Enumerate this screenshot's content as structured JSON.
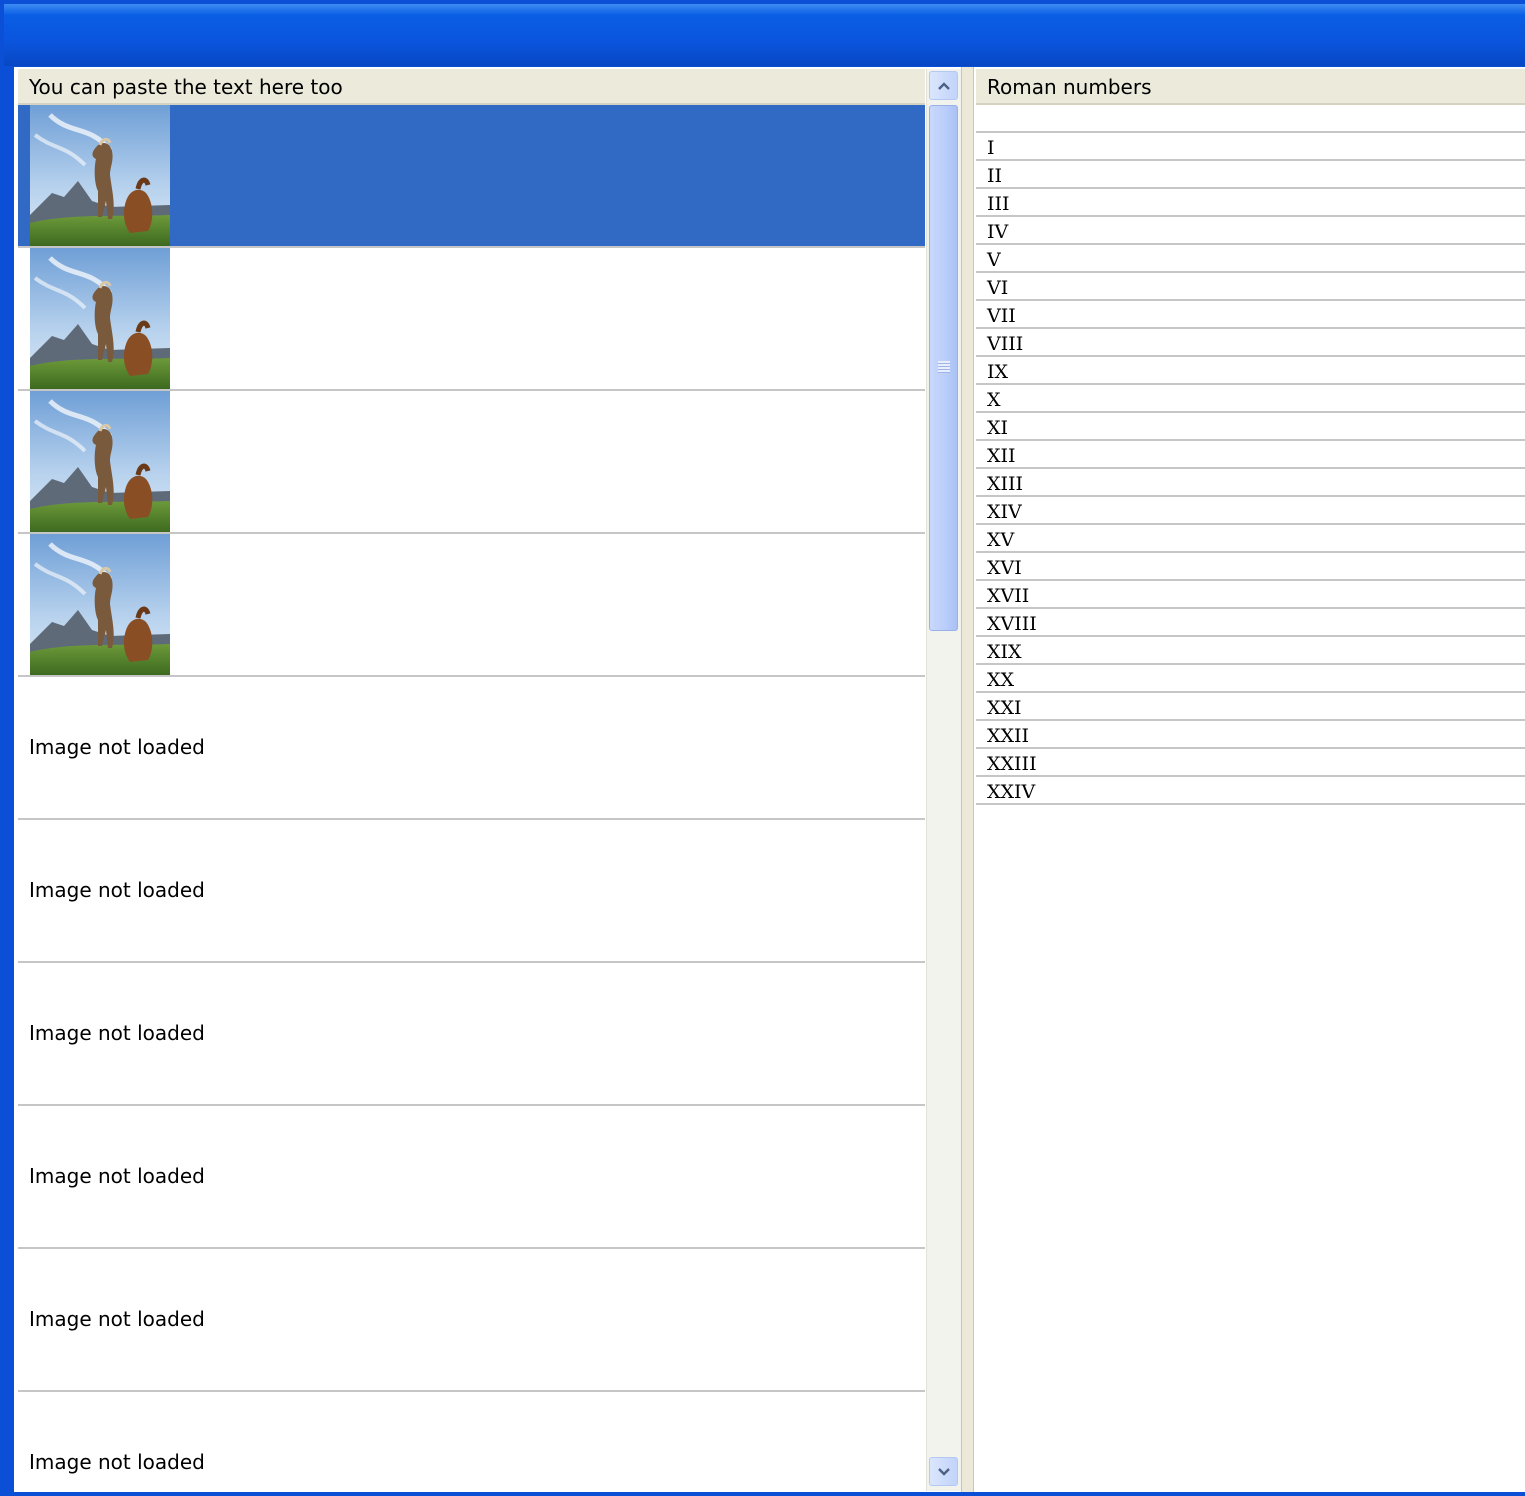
{
  "colors": {
    "title_bar": "#0a55dd",
    "selection": "#316ac5",
    "header_bg": "#ebeadb",
    "row_divider": "#c6c6c6"
  },
  "left_list": {
    "header": "You can paste the text here too",
    "rows": [
      {
        "image": "horses-photo",
        "text": ""
      },
      {
        "image": "horses-photo",
        "text": ""
      },
      {
        "image": "horses-photo",
        "text": ""
      },
      {
        "image": "horses-photo",
        "text": ""
      },
      {
        "image": null,
        "text": "Image not loaded"
      },
      {
        "image": null,
        "text": "Image not loaded"
      },
      {
        "image": null,
        "text": "Image not loaded"
      },
      {
        "image": null,
        "text": "Image not loaded"
      },
      {
        "image": null,
        "text": "Image not loaded"
      },
      {
        "image": null,
        "text": "Image not loaded"
      }
    ],
    "selected_index": 0
  },
  "scrollbar": {
    "up_icon": "chevron-up-icon",
    "down_icon": "chevron-down-icon"
  },
  "right_list": {
    "header": "Roman numbers",
    "items": [
      "",
      "I",
      "II",
      "III",
      "IV",
      "V",
      "VI",
      "VII",
      "VIII",
      "IX",
      "X",
      "XI",
      "XII",
      "XIII",
      "XIV",
      "XV",
      "XVI",
      "XVII",
      "XVIII",
      "XIX",
      "XX",
      "XXI",
      "XXII",
      "XXIII",
      "XXIV"
    ]
  }
}
